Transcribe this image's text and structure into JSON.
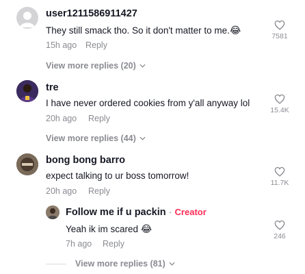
{
  "comments": [
    {
      "username": "user1211586911427",
      "text": "They still smack tho. So it don't matter to me.",
      "emoji": "😂",
      "time": "15h ago",
      "reply_label": "Reply",
      "likes": "7581",
      "view_more": "View more replies (20)",
      "avatar_color": "#d4d4d6"
    },
    {
      "username": "tre",
      "text": "I have never ordered cookies from y'all anyway lol",
      "time": "20h ago",
      "reply_label": "Reply",
      "likes": "15.4K",
      "view_more": "View more replies (44)",
      "avatar_color": "#3b2a5e"
    },
    {
      "username": "bong bong barro",
      "text": "expect talking to ur boss tomorrow!",
      "time": "20h ago",
      "reply_label": "Reply",
      "likes": "11.7K",
      "avatar_color": "#5a4a3e"
    }
  ],
  "reply": {
    "username": "Follow me if u packin",
    "separator": "·",
    "badge": "Creator",
    "text": "Yeah ik im scared",
    "emoji": "😂",
    "time": "7h ago",
    "reply_label": "Reply",
    "likes": "246",
    "view_more": "View more replies (81)",
    "avatar_color": "#6b5a4a"
  },
  "colors": {
    "accent": "#fe2c55",
    "muted": "#8a8b91",
    "text": "#161823"
  },
  "icons": {
    "like": "heart-outline-icon",
    "expand": "chevron-down-icon",
    "default_avatar": "person-icon"
  }
}
